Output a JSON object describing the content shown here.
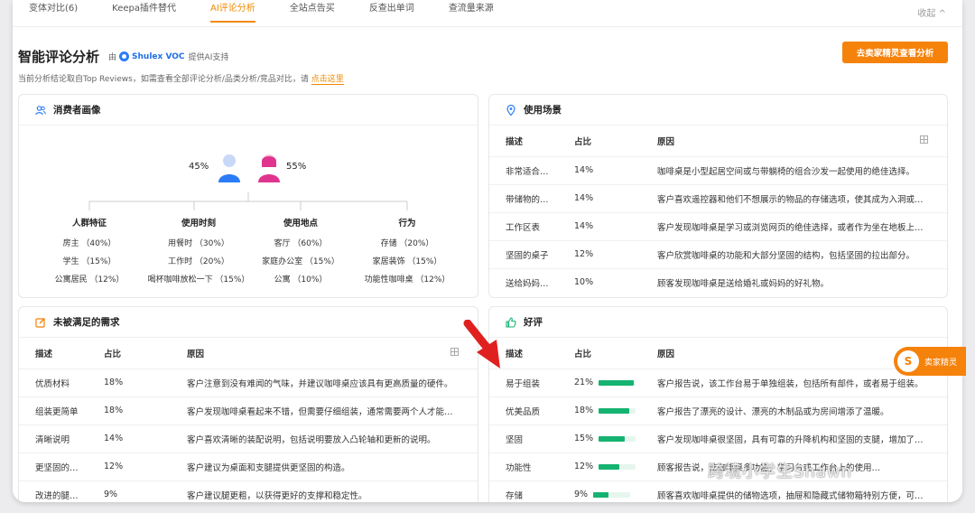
{
  "tabs": [
    "变体对比(6)",
    "Keepa插件替代",
    "AI评论分析",
    "全站点告买",
    "反查出单词",
    "查流量来源"
  ],
  "collapse_label": "收起",
  "title": "智能评论分析",
  "by_prefix": "由",
  "brand": "Shulex VOC",
  "brand_suffix": "提供AI支持",
  "subtitle": "当前分析结论取自Top Reviews，如需查看全部评论分析/品类分析/竞品对比，请",
  "subtitle_link": "点击这里",
  "cta_label": "去卖家精灵查看分析",
  "consumer": {
    "title": "消费者画像",
    "male_pct": "45%",
    "female_pct": "55%",
    "categories": [
      {
        "title": "人群特征",
        "items": [
          "房主 （40%）",
          "学生 （15%）",
          "公寓居民 （12%）"
        ]
      },
      {
        "title": "使用时刻",
        "items": [
          "用餐时 （30%）",
          "工作时 （20%）",
          "喝杯咖啡放松一下 （15%）"
        ]
      },
      {
        "title": "使用地点",
        "items": [
          "客厅 （60%）",
          "家庭办公室 （15%）",
          "公寓 （10%）"
        ]
      },
      {
        "title": "行为",
        "items": [
          "存储 （20%）",
          "家居装饰 （15%）",
          "功能性咖啡桌 （12%）"
        ]
      }
    ]
  },
  "scenario": {
    "title": "使用场景",
    "headers": [
      "描述",
      "占比",
      "原因"
    ],
    "rows": [
      {
        "desc": "非常适合…",
        "pct": "14%",
        "reason": "咖啡桌是小型起居空间或与带躺椅的组合沙发一起使用的绝佳选择。"
      },
      {
        "desc": "带储物的…",
        "pct": "14%",
        "reason": "客户喜欢遥控器和他们不想展示的物品的存储选项，使其成为入洞或…"
      },
      {
        "desc": "工作区表",
        "pct": "14%",
        "reason": "客户发现咖啡桌是学习或浏览网页的绝佳选择，或者作为坐在地板上…"
      },
      {
        "desc": "坚固的桌子",
        "pct": "12%",
        "reason": "客户欣赏咖啡桌的功能和大部分坚固的结构，包括坚固的拉出部分。"
      },
      {
        "desc": "送给妈妈…",
        "pct": "10%",
        "reason": "顾客发现咖啡桌是送给婚礼或妈妈的好礼物。"
      }
    ]
  },
  "unmet": {
    "title": "未被满足的需求",
    "headers": [
      "描述",
      "占比",
      "原因"
    ],
    "rows": [
      {
        "desc": "优质材料",
        "pct": "18%",
        "reason": "客户注意到没有难闻的气味，并建议咖啡桌应该具有更高质量的硬件。"
      },
      {
        "desc": "组装更简单",
        "pct": "18%",
        "reason": "客户发现咖啡桌看起来不错，但需要仔细组装，通常需要两个人才能…"
      },
      {
        "desc": "清晰说明",
        "pct": "14%",
        "reason": "客户喜欢清晰的装配说明，包括说明要放入凸轮轴和更新的说明。"
      },
      {
        "desc": "更坚固的…",
        "pct": "12%",
        "reason": "客户建议为桌面和支腿提供更坚固的构造。"
      },
      {
        "desc": "改进的腿…",
        "pct": "9%",
        "reason": "客户建议腿更粗，以获得更好的支撑和稳定性。"
      }
    ]
  },
  "praise": {
    "title": "好评",
    "headers": [
      "描述",
      "占比",
      "原因"
    ],
    "rows": [
      {
        "desc": "易于组装",
        "pct": "21%",
        "value": 0.95,
        "reason": "客户报告说，该工作台易于单独组装，包括所有部件，或者易于组装。"
      },
      {
        "desc": "优美品质",
        "pct": "18%",
        "value": 0.82,
        "reason": "客户报告了漂亮的设计、漂亮的木制品或为房间增添了温暖。"
      },
      {
        "desc": "坚固",
        "pct": "15%",
        "value": 0.7,
        "reason": "客户发现咖啡桌很坚固，具有可靠的升降机构和坚固的支腿，增加了…"
      },
      {
        "desc": "功能性",
        "pct": "12%",
        "value": 0.55,
        "reason": "顾客报告说，该咖啡桌多功能，学习台或工作台上的使用…"
      },
      {
        "desc": "存储",
        "pct": "9%",
        "value": 0.42,
        "reason": "顾客喜欢咖啡桌提供的储物选项，抽屉和隐藏式储物箱特别方便，可…"
      }
    ]
  },
  "float_badge": {
    "logo": "S",
    "label": "卖家精灵"
  },
  "watermark": "跨境小学生Shawn",
  "colors": {
    "accent": "#f5820b",
    "bar": "#15b371",
    "brand": "#1f6fe5",
    "male": "#2b7cf6",
    "female": "#e0358f"
  }
}
